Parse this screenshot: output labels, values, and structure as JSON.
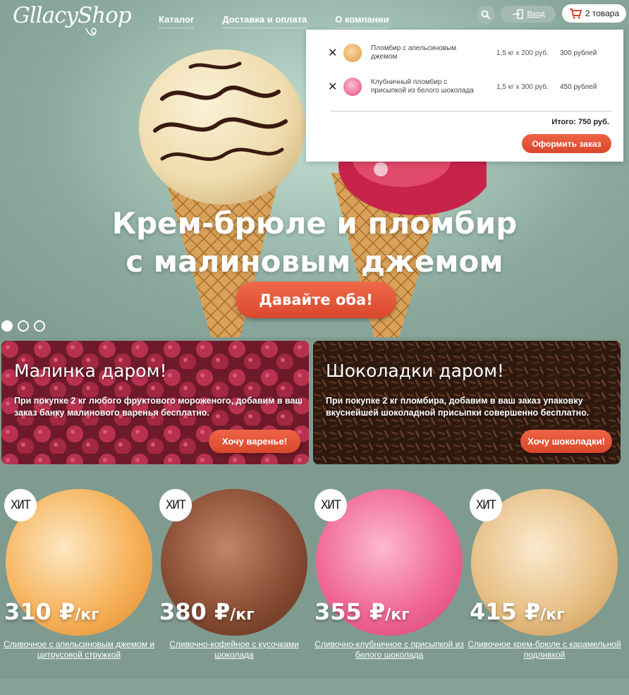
{
  "header": {
    "logo": "GllacyShop",
    "nav": [
      "Каталог",
      "Доставка и оплата",
      "О компании"
    ],
    "login_label": "Вход",
    "cart_label": "2 товара"
  },
  "cart": {
    "items": [
      {
        "name": "Пломбир с апельсиновым джемом",
        "qty": "1,5 кг х 200 руб.",
        "sum": "300 рублей"
      },
      {
        "name": "Клубничный пломбир с присыпкой из белого шоколада",
        "qty": "1,5 кг х 300 руб.",
        "sum": "450 рублей"
      }
    ],
    "total": "Итого: 750 руб.",
    "order_button": "Оформить заказ"
  },
  "hero": {
    "title_line1": "Крем-брюле и пломбир",
    "title_line2": "с малиновым джемом",
    "button": "Давайте оба!"
  },
  "promos": [
    {
      "title": "Малинка даром!",
      "text": "При покупке 2 кг любого фруктового мороженого, добавим в ваш заказ банку малинового варенья бесплатно.",
      "button": "Хочу варенье!"
    },
    {
      "title": "Шоколадки даром!",
      "text": "При покупке 2 кг пломбира, добавим в ваш заказ упаковку вкуснейшей шоколадной присыпки совершенно бесплатно.",
      "button": "Хочу шоколадки!"
    }
  ],
  "products": [
    {
      "badge": "ХИТ",
      "price": "310 ₽",
      "unit": "/кг",
      "name": "Сливочное с апельсиновым джемом и цитрусовой стружкой"
    },
    {
      "badge": "ХИТ",
      "price": "380 ₽",
      "unit": "/кг",
      "name": "Сливочно-кофейное с кусочками шоколада"
    },
    {
      "badge": "ХИТ",
      "price": "355 ₽",
      "unit": "/кг",
      "name": "Сливочно-клубничное с присыпкой из белого шоколада"
    },
    {
      "badge": "ХИТ",
      "price": "415 ₽",
      "unit": "/кг",
      "name": "Сливочное крем-брюле с карамельной подливкой"
    }
  ],
  "colors": {
    "accent": "#e0573a",
    "background": "#7f9b8f"
  }
}
